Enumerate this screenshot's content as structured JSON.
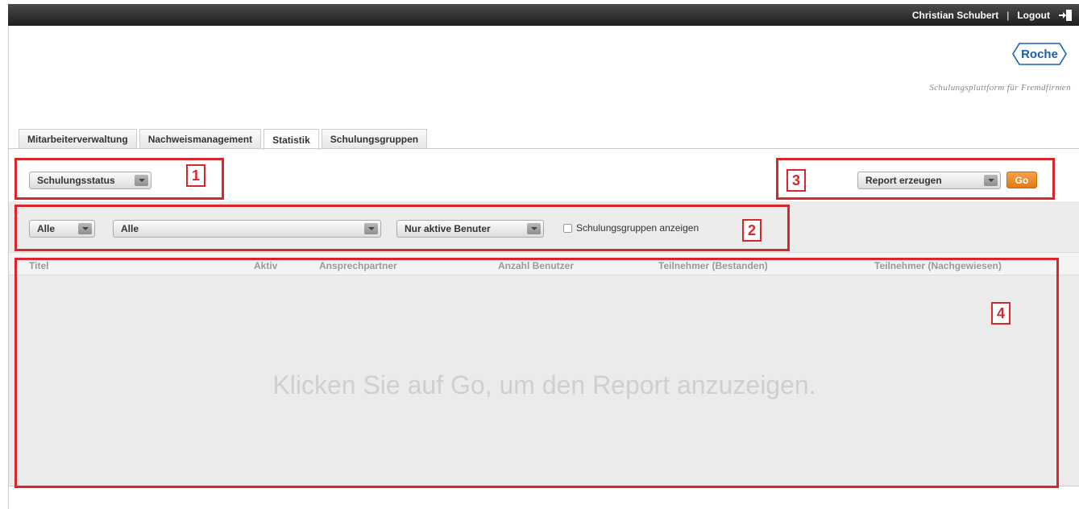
{
  "topbar": {
    "user_name": "Christian Schubert",
    "separator": "|",
    "logout_label": "Logout"
  },
  "brand": {
    "logo_text": "Roche",
    "tagline": "Schulungsplattform für Fremdfirmen"
  },
  "tabs": [
    {
      "label": "Mitarbeiterverwaltung"
    },
    {
      "label": "Nachweismanagement"
    },
    {
      "label": "Statistik",
      "active": true
    },
    {
      "label": "Schulungsgruppen"
    }
  ],
  "report_type": {
    "selected": "Schulungsstatus"
  },
  "report_action": {
    "selected": "Report erzeugen",
    "go_label": "Go"
  },
  "filters": {
    "filter1": "Alle",
    "filter2": "Alle",
    "user_status": "Nur aktive Benuter",
    "show_groups_label": "Schulungsgruppen anzeigen"
  },
  "table": {
    "columns": [
      "Titel",
      "Aktiv",
      "Ansprechpartner",
      "Anzahl Benutzer",
      "Teilnehmer (Bestanden)",
      "Teilnehmer (Nachgewiesen)"
    ],
    "empty_message": "Klicken Sie auf Go, um den Report anzuzeigen."
  },
  "callouts": [
    "1",
    "2",
    "3",
    "4"
  ],
  "colors": {
    "callout": "#d9262a",
    "go_button": "#e8841d",
    "brand": "#1a5fa8",
    "topbar": "#2a2a2a"
  }
}
